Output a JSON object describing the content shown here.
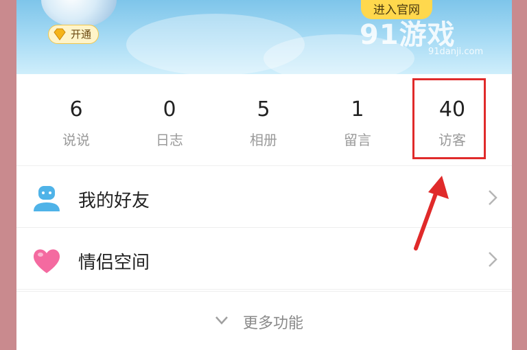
{
  "banner": {
    "vip_label": "开通",
    "enter_site_label": "进入官网",
    "watermark_text": "91游戏",
    "watermark_domain": "91danji.com"
  },
  "stats": [
    {
      "value": "6",
      "label": "说说"
    },
    {
      "value": "0",
      "label": "日志"
    },
    {
      "value": "5",
      "label": "相册"
    },
    {
      "value": "1",
      "label": "留言"
    },
    {
      "value": "40",
      "label": "访客"
    }
  ],
  "menu": {
    "friends_label": "我的好友",
    "couple_label": "情侣空间",
    "more_label": "更多功能"
  },
  "icons": {
    "friends": "person-icon",
    "couple": "heart-icon",
    "chevron": "chevron-right-icon",
    "more": "chevron-down-icon"
  },
  "colors": {
    "highlight": "#e02a2a",
    "friends_icon": "#4fb3e8",
    "couple_icon": "#f46aa0"
  }
}
